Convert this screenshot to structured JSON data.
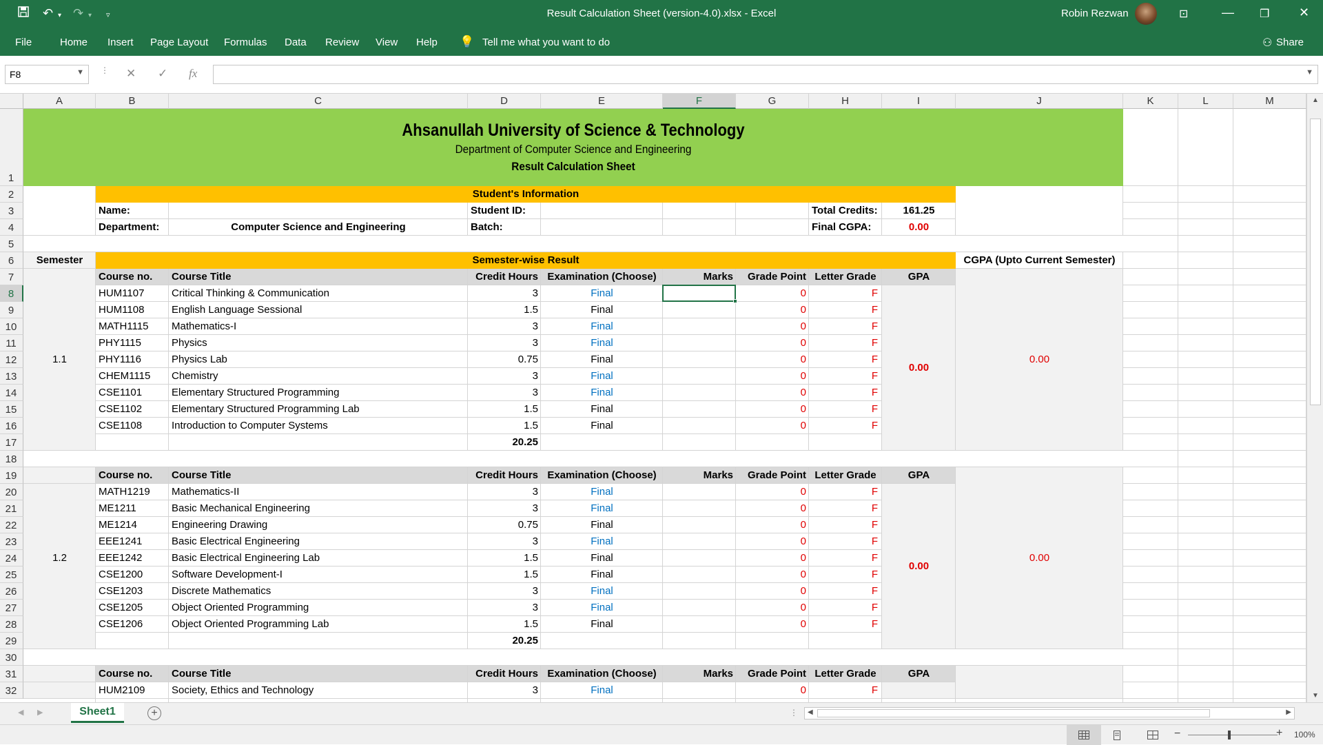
{
  "window": {
    "title": "Result Calculation Sheet (version-4.0).xlsx  -  Excel",
    "user": "Robin Rezwan",
    "share": "Share"
  },
  "ribbon": {
    "tabs": [
      "File",
      "Home",
      "Insert",
      "Page Layout",
      "Formulas",
      "Data",
      "Review",
      "View",
      "Help"
    ],
    "tell_me": "Tell me what you want to do"
  },
  "formula_bar": {
    "name_box": "F8",
    "fx": "fx",
    "value": ""
  },
  "columns": [
    "A",
    "B",
    "C",
    "D",
    "E",
    "F",
    "G",
    "H",
    "I",
    "J",
    "K",
    "L",
    "M"
  ],
  "selected_cell": "F8",
  "header": {
    "university": "Ahsanullah University of Science & Technology",
    "department": "Department of Computer Science and Engineering",
    "sheet_title": "Result Calculation Sheet"
  },
  "student_info": {
    "section_title": "Student's Information",
    "name_label": "Name:",
    "name_value": "",
    "student_id_label": "Student ID:",
    "student_id_value": "",
    "total_credits_label": "Total Credits:",
    "total_credits_value": "161.25",
    "department_label": "Department:",
    "department_value": "Computer Science and Engineering",
    "batch_label": "Batch:",
    "batch_value": "",
    "final_cgpa_label": "Final CGPA:",
    "final_cgpa_value": "0.00"
  },
  "semester_result": {
    "semester_label": "Semester",
    "section_title": "Semester-wise Result",
    "cgpa_label": "CGPA (Upto Current Semester)",
    "table_headers": {
      "course_no": "Course no.",
      "course_title": "Course Title",
      "credit_hours": "Credit Hours",
      "examination": "Examination (Choose)",
      "marks": "Marks",
      "grade_point": "Grade Point",
      "letter_grade": "Letter Grade",
      "gpa": "GPA"
    }
  },
  "semesters": [
    {
      "id": "1.1",
      "gpa": "0.00",
      "cgpa": "0.00",
      "total_credits": "20.25",
      "courses": [
        {
          "no": "HUM1107",
          "title": "Critical Thinking & Communication",
          "credit": "3",
          "exam": "Final",
          "marks": "",
          "gp": "0",
          "lg": "F",
          "exam_color": "blue"
        },
        {
          "no": "HUM1108",
          "title": "English Language Sessional",
          "credit": "1.5",
          "exam": "Final",
          "marks": "",
          "gp": "0",
          "lg": "F",
          "exam_color": "black"
        },
        {
          "no": "MATH1115",
          "title": "Mathematics-I",
          "credit": "3",
          "exam": "Final",
          "marks": "",
          "gp": "0",
          "lg": "F",
          "exam_color": "blue"
        },
        {
          "no": "PHY1115",
          "title": "Physics",
          "credit": "3",
          "exam": "Final",
          "marks": "",
          "gp": "0",
          "lg": "F",
          "exam_color": "blue"
        },
        {
          "no": "PHY1116",
          "title": "Physics Lab",
          "credit": "0.75",
          "exam": "Final",
          "marks": "",
          "gp": "0",
          "lg": "F",
          "exam_color": "black"
        },
        {
          "no": "CHEM1115",
          "title": "Chemistry",
          "credit": "3",
          "exam": "Final",
          "marks": "",
          "gp": "0",
          "lg": "F",
          "exam_color": "blue"
        },
        {
          "no": "CSE1101",
          "title": "Elementary Structured Programming",
          "credit": "3",
          "exam": "Final",
          "marks": "",
          "gp": "0",
          "lg": "F",
          "exam_color": "blue"
        },
        {
          "no": "CSE1102",
          "title": "Elementary Structured Programming Lab",
          "credit": "1.5",
          "exam": "Final",
          "marks": "",
          "gp": "0",
          "lg": "F",
          "exam_color": "black"
        },
        {
          "no": "CSE1108",
          "title": "Introduction to Computer Systems",
          "credit": "1.5",
          "exam": "Final",
          "marks": "",
          "gp": "0",
          "lg": "F",
          "exam_color": "black"
        }
      ]
    },
    {
      "id": "1.2",
      "gpa": "0.00",
      "cgpa": "0.00",
      "total_credits": "20.25",
      "courses": [
        {
          "no": "MATH1219",
          "title": "Mathematics-II",
          "credit": "3",
          "exam": "Final",
          "marks": "",
          "gp": "0",
          "lg": "F",
          "exam_color": "blue"
        },
        {
          "no": "ME1211",
          "title": "Basic Mechanical Engineering",
          "credit": "3",
          "exam": "Final",
          "marks": "",
          "gp": "0",
          "lg": "F",
          "exam_color": "blue"
        },
        {
          "no": "ME1214",
          "title": "Engineering Drawing",
          "credit": "0.75",
          "exam": "Final",
          "marks": "",
          "gp": "0",
          "lg": "F",
          "exam_color": "black"
        },
        {
          "no": "EEE1241",
          "title": "Basic Electrical Engineering",
          "credit": "3",
          "exam": "Final",
          "marks": "",
          "gp": "0",
          "lg": "F",
          "exam_color": "blue"
        },
        {
          "no": "EEE1242",
          "title": "Basic Electrical Engineering Lab",
          "credit": "1.5",
          "exam": "Final",
          "marks": "",
          "gp": "0",
          "lg": "F",
          "exam_color": "black"
        },
        {
          "no": "CSE1200",
          "title": "Software Development-I",
          "credit": "1.5",
          "exam": "Final",
          "marks": "",
          "gp": "0",
          "lg": "F",
          "exam_color": "black"
        },
        {
          "no": "CSE1203",
          "title": "Discrete Mathematics",
          "credit": "3",
          "exam": "Final",
          "marks": "",
          "gp": "0",
          "lg": "F",
          "exam_color": "blue"
        },
        {
          "no": "CSE1205",
          "title": "Object Oriented Programming",
          "credit": "3",
          "exam": "Final",
          "marks": "",
          "gp": "0",
          "lg": "F",
          "exam_color": "blue"
        },
        {
          "no": "CSE1206",
          "title": "Object Oriented Programming Lab",
          "credit": "1.5",
          "exam": "Final",
          "marks": "",
          "gp": "0",
          "lg": "F",
          "exam_color": "black"
        }
      ]
    },
    {
      "id": "",
      "gpa": "",
      "cgpa": "",
      "total_credits": "",
      "courses": [
        {
          "no": "HUM2109",
          "title": "Society, Ethics and Technology",
          "credit": "3",
          "exam": "Final",
          "marks": "",
          "gp": "0",
          "lg": "F",
          "exam_color": "blue"
        }
      ]
    }
  ],
  "sheets": [
    "Sheet1"
  ],
  "status": {
    "zoom": "100%"
  },
  "colors": {
    "excel_green": "#217346",
    "banner_green": "#92d050",
    "orange": "#ffc000",
    "header_gray": "#d9d9d9",
    "body_gray": "#f2f2f2",
    "red": "#e00000",
    "blue": "#0070c0"
  }
}
